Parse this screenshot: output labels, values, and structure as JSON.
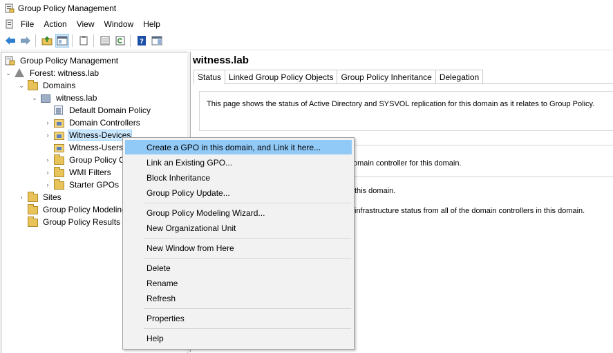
{
  "window": {
    "title": "Group Policy Management"
  },
  "menu": {
    "items": [
      "File",
      "Action",
      "View",
      "Window",
      "Help"
    ]
  },
  "toolbar": {
    "icons": [
      "back-arrow-icon",
      "forward-arrow-icon",
      "folder-up-icon",
      "show-hide-tree-icon",
      "properties-icon",
      "export-list-icon",
      "refresh-icon",
      "help-icon",
      "action-pane-icon"
    ]
  },
  "tree": {
    "root": "Group Policy Management",
    "forest": "Forest: witness.lab",
    "domains": "Domains",
    "domain": "witness.lab",
    "default_policy": "Default Domain Policy",
    "domain_controllers": "Domain Controllers",
    "witness_devices": "Witness-Devices",
    "witness_users": "Witness-Users",
    "gpo_objects": "Group Policy O",
    "wmi_filters": "WMI Filters",
    "starter_gpos": "Starter GPOs",
    "sites": "Sites",
    "modeling": "Group Policy Modeling",
    "results": "Group Policy Results"
  },
  "right": {
    "title": "witness.lab",
    "tabs": [
      "Status",
      "Linked Group Policy Objects",
      "Group Policy Inheritance",
      "Delegation"
    ],
    "status_text": "This page shows the status of Active Directory and SYSVOL replication for this domain as it relates to Group Policy.",
    "line1": "omain controller for this domain.",
    "line2": "this domain.",
    "line3": "infrastructure status from all of the domain controllers in this domain."
  },
  "context_menu": {
    "create_gpo": "Create a GPO in this domain, and Link it here...",
    "link_existing": "Link an Existing GPO...",
    "block_inheritance": "Block Inheritance",
    "gp_update": "Group Policy Update...",
    "modeling_wizard": "Group Policy Modeling Wizard...",
    "new_ou": "New Organizational Unit",
    "new_window": "New Window from Here",
    "delete": "Delete",
    "rename": "Rename",
    "refresh": "Refresh",
    "properties": "Properties",
    "help": "Help"
  },
  "colors": {
    "selection": "#cce8ff",
    "menu_highlight": "#91c9f7",
    "folder": "#e8c35a"
  }
}
